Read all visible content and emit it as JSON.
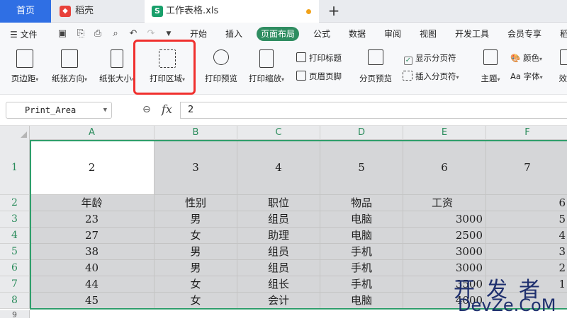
{
  "tabs": {
    "home": "首页",
    "daoke": "稻壳",
    "file": "工作表格.xls",
    "add": "+"
  },
  "menu": {
    "file_label": "文件",
    "items": [
      "开始",
      "插入",
      "页面布局",
      "公式",
      "数据",
      "审阅",
      "视图",
      "开发工具",
      "会员专享",
      "稻"
    ]
  },
  "ribbon": {
    "margins": "页边距",
    "orientation": "纸张方向",
    "size": "纸张大小",
    "print_area": "打印区域",
    "print_preview": "打印预览",
    "print_scale": "打印缩放",
    "print_titles": "打印标题",
    "header_footer": "页眉页脚",
    "page_break_preview": "分页预览",
    "show_page_breaks": "显示分页符",
    "insert_page_break": "插入分页符",
    "theme": "主题",
    "colors": "颜色",
    "fonts": "Aa 字体",
    "effects": "效果"
  },
  "formula_bar": {
    "name_box": "Print_Area",
    "fx": "fx",
    "value": "2"
  },
  "columns": [
    "A",
    "B",
    "C",
    "D",
    "E",
    "F"
  ],
  "rows": [
    {
      "num": "1",
      "cells": [
        "2",
        "3",
        "4",
        "5",
        "6",
        "7"
      ]
    },
    {
      "num": "2",
      "cells": [
        "年龄",
        "性别",
        "职位",
        "物品",
        "工资",
        "6"
      ]
    },
    {
      "num": "3",
      "cells": [
        "23",
        "男",
        "组员",
        "电脑",
        "3000",
        "5"
      ]
    },
    {
      "num": "4",
      "cells": [
        "27",
        "女",
        "助理",
        "电脑",
        "2500",
        "4"
      ]
    },
    {
      "num": "5",
      "cells": [
        "38",
        "男",
        "组员",
        "手机",
        "3000",
        "3"
      ]
    },
    {
      "num": "6",
      "cells": [
        "40",
        "男",
        "组员",
        "手机",
        "3000",
        "2"
      ]
    },
    {
      "num": "7",
      "cells": [
        "44",
        "女",
        "组长",
        "手机",
        "3500",
        "1"
      ]
    },
    {
      "num": "8",
      "cells": [
        "45",
        "女",
        "会计",
        "电脑",
        "4000",
        ""
      ]
    }
  ],
  "row9": "9",
  "watermark": {
    "line1": "开发者",
    "line2": "DevZe.CoM"
  }
}
